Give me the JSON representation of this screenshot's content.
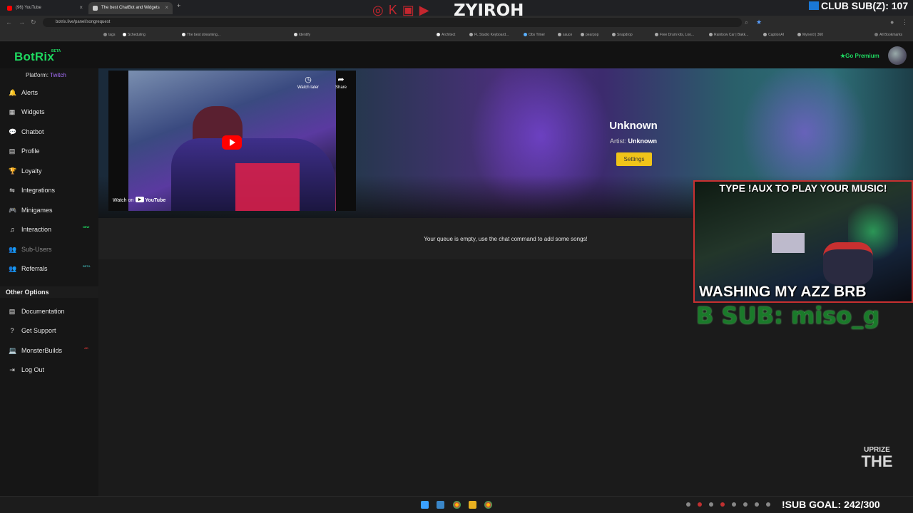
{
  "browser": {
    "tabs": [
      {
        "title": "(96) YouTube"
      },
      {
        "title": "The best ChatBot and Widgets"
      }
    ],
    "url": "botrix.live/panel/songrequest",
    "bookmarks": [
      "tags",
      "Scheduling",
      "The best streaming...",
      "Identify",
      "Architect",
      "FL Studio Keyboard...",
      "Obs Timer",
      "sauce",
      "pearpop",
      "Snapdrop",
      "Free Drum kits, Loo...",
      "Rainbow Car | Bakk...",
      "CaptionAI",
      "Mynerd | 360"
    ],
    "all_bookmarks": "All Bookmarks"
  },
  "header": {
    "logo": "BotRix",
    "beta": "BETA",
    "premium": "Go Premium"
  },
  "sidebar": {
    "platform_label": "Platform:",
    "platform_value": "Twitch",
    "items": [
      {
        "label": "Alerts",
        "icon": "bell-icon",
        "glyph": "🔔"
      },
      {
        "label": "Widgets",
        "icon": "grid-icon",
        "glyph": "▦"
      },
      {
        "label": "Chatbot",
        "icon": "chat-icon",
        "glyph": "💬"
      },
      {
        "label": "Profile",
        "icon": "id-card-icon",
        "glyph": "▤"
      },
      {
        "label": "Loyalty",
        "icon": "trophy-icon",
        "glyph": "🏆"
      },
      {
        "label": "Integrations",
        "icon": "plug-icon",
        "glyph": "⇋"
      },
      {
        "label": "Minigames",
        "icon": "gamepad-icon",
        "glyph": "🎮"
      },
      {
        "label": "Interaction",
        "icon": "music-icon",
        "glyph": "♫",
        "badge": "NEW"
      },
      {
        "label": "Sub-Users",
        "icon": "users-icon",
        "glyph": "👥"
      },
      {
        "label": "Referrals",
        "icon": "users-icon",
        "glyph": "👥",
        "badge": "BETA"
      }
    ],
    "other_header": "Other Options",
    "other_items": [
      {
        "label": "Documentation",
        "icon": "document-icon",
        "glyph": "▤"
      },
      {
        "label": "Get Support",
        "icon": "question-icon",
        "glyph": "?"
      },
      {
        "label": "MonsterBuilds",
        "icon": "laptop-icon",
        "glyph": "💻",
        "badge": "AD"
      },
      {
        "label": "Log Out",
        "icon": "logout-icon",
        "glyph": "⇥"
      }
    ]
  },
  "player": {
    "watch_later": "Watch later",
    "share": "Share",
    "watch_on": "Watch on",
    "yt_brand": "YouTube"
  },
  "song": {
    "title": "Unknown",
    "artist_label": "Artist:",
    "artist_value": "Unknown",
    "settings_label": "Settings",
    "queue_message": "Your queue is empty, use the chat command to add some songs!"
  },
  "stream_overlay": {
    "channel_name": "ZYIROH",
    "club_sub": "CLUB SUB(Z): 107",
    "cam_top_text": "TYPE !AUX TO PLAY YOUR MUSIC!",
    "cam_bottom_text": "WASHING MY AZZ BRB",
    "last_sub": "B SUB: miso_g",
    "sub_goal": "!SUB      GOAL: 242/300",
    "corner_logo_top": "UPRIZE",
    "corner_logo_mid": "THE"
  },
  "colors": {
    "brand_green": "#1ed760",
    "twitch_purple": "#a970ff",
    "settings_yellow": "#f0c419",
    "youtube_red": "#ff0000"
  }
}
